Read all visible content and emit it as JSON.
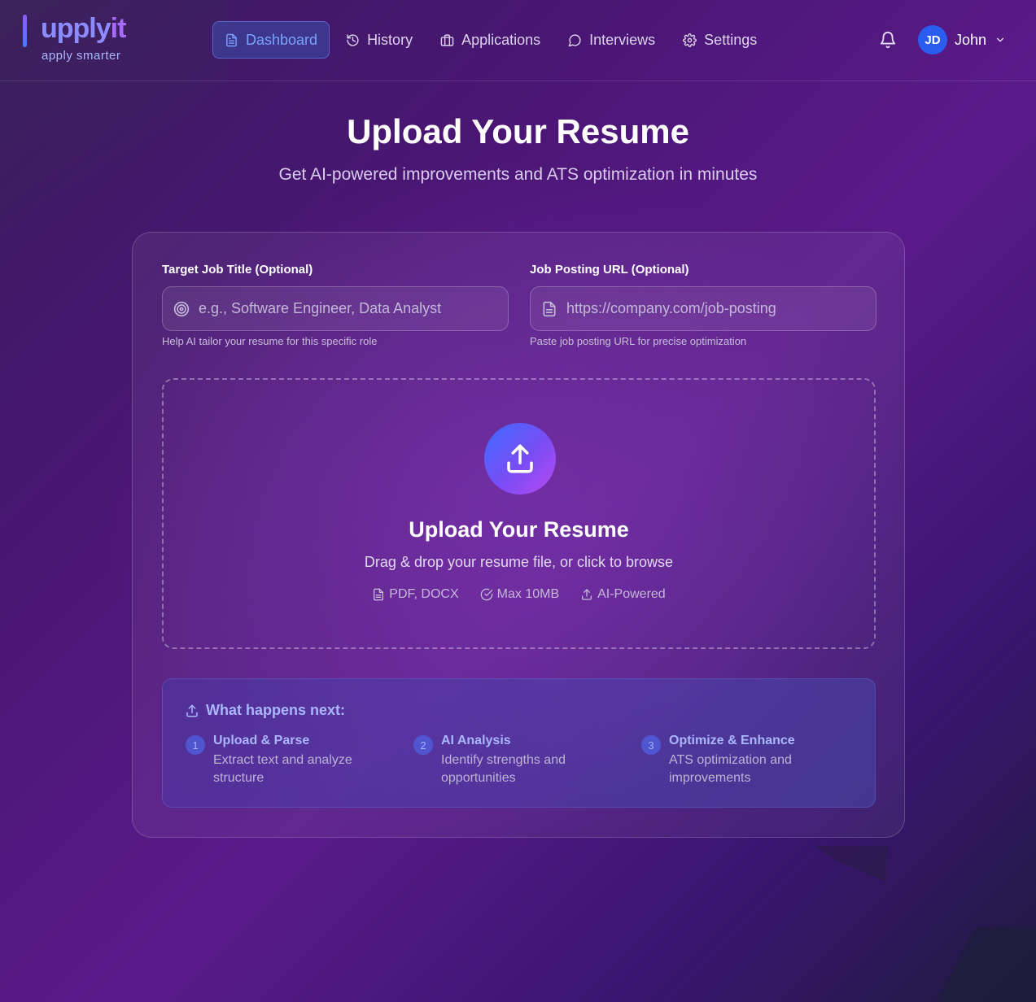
{
  "brand": {
    "name_part1": "upply",
    "name_part2": "it",
    "tagline": "apply smarter"
  },
  "nav": {
    "items": [
      {
        "label": "Dashboard",
        "icon": "document-icon",
        "active": true
      },
      {
        "label": "History",
        "icon": "history-icon",
        "active": false
      },
      {
        "label": "Applications",
        "icon": "briefcase-icon",
        "active": false
      },
      {
        "label": "Interviews",
        "icon": "chat-bubble-icon",
        "active": false
      },
      {
        "label": "Settings",
        "icon": "gear-icon",
        "active": false
      }
    ]
  },
  "user": {
    "initials": "JD",
    "name": "John"
  },
  "hero": {
    "title": "Upload Your Resume",
    "subtitle": "Get AI-powered improvements and ATS optimization in minutes"
  },
  "form": {
    "job_title": {
      "label": "Target Job Title (Optional)",
      "placeholder": "e.g., Software Engineer, Data Analyst",
      "value": "",
      "help": "Help AI tailor your resume for this specific role"
    },
    "job_url": {
      "label": "Job Posting URL (Optional)",
      "placeholder": "https://company.com/job-posting",
      "value": "",
      "help": "Paste job posting URL for precise optimization"
    }
  },
  "dropzone": {
    "title": "Upload Your Resume",
    "subtitle": "Drag & drop your resume file, or click to browse",
    "features": [
      {
        "label": "PDF, DOCX",
        "icon": "file-icon"
      },
      {
        "label": "Max 10MB",
        "icon": "check-circle-icon"
      },
      {
        "label": "AI-Powered",
        "icon": "upload-icon"
      }
    ]
  },
  "next_steps": {
    "title": "What happens next:",
    "steps": [
      {
        "num": "1",
        "title": "Upload & Parse",
        "desc": "Extract text and analyze structure"
      },
      {
        "num": "2",
        "title": "AI Analysis",
        "desc": "Identify strengths and opportunities"
      },
      {
        "num": "3",
        "title": "Optimize & Enhance",
        "desc": "ATS optimization and improvements"
      }
    ]
  },
  "colors": {
    "accent": "#7aa2ff",
    "avatar": "#2b5cf0",
    "upload_gradient_start": "#3d6cff",
    "upload_gradient_end": "#b84cf0"
  }
}
